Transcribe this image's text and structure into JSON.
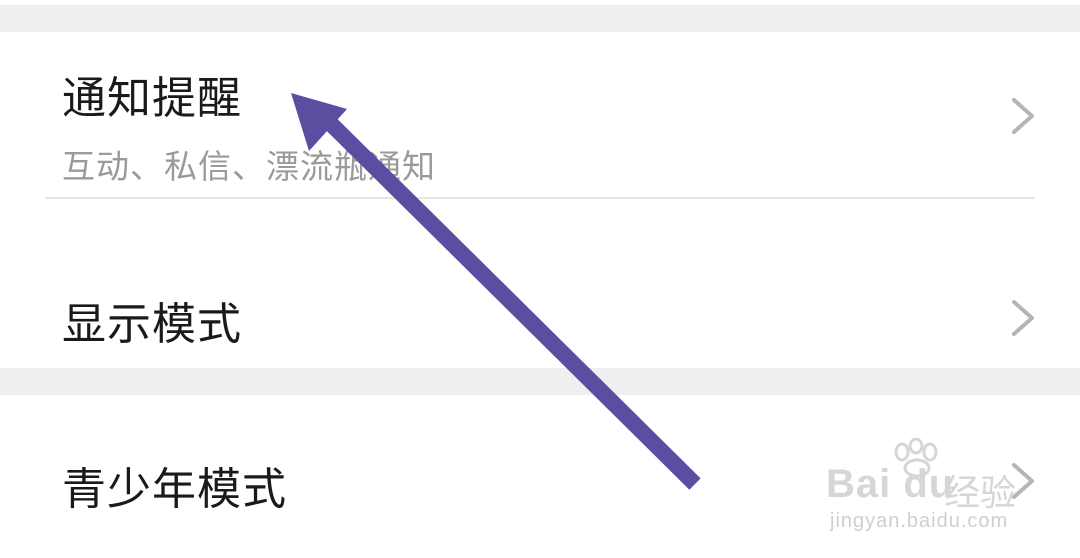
{
  "settings": {
    "rows": [
      {
        "title": "通知提醒",
        "subtitle": "互动、私信、漂流瓶通知"
      },
      {
        "title": "显示模式"
      },
      {
        "title": "青少年模式"
      }
    ]
  },
  "annotation": {
    "arrow_color": "#5b4ea1"
  },
  "watermark": {
    "logo": "Bai du",
    "cn": "经验",
    "url": "jingyan.baidu.com"
  },
  "icons": {
    "chevron": "chevron-right-icon",
    "watermark_paw": "baidu-paw-icon"
  }
}
